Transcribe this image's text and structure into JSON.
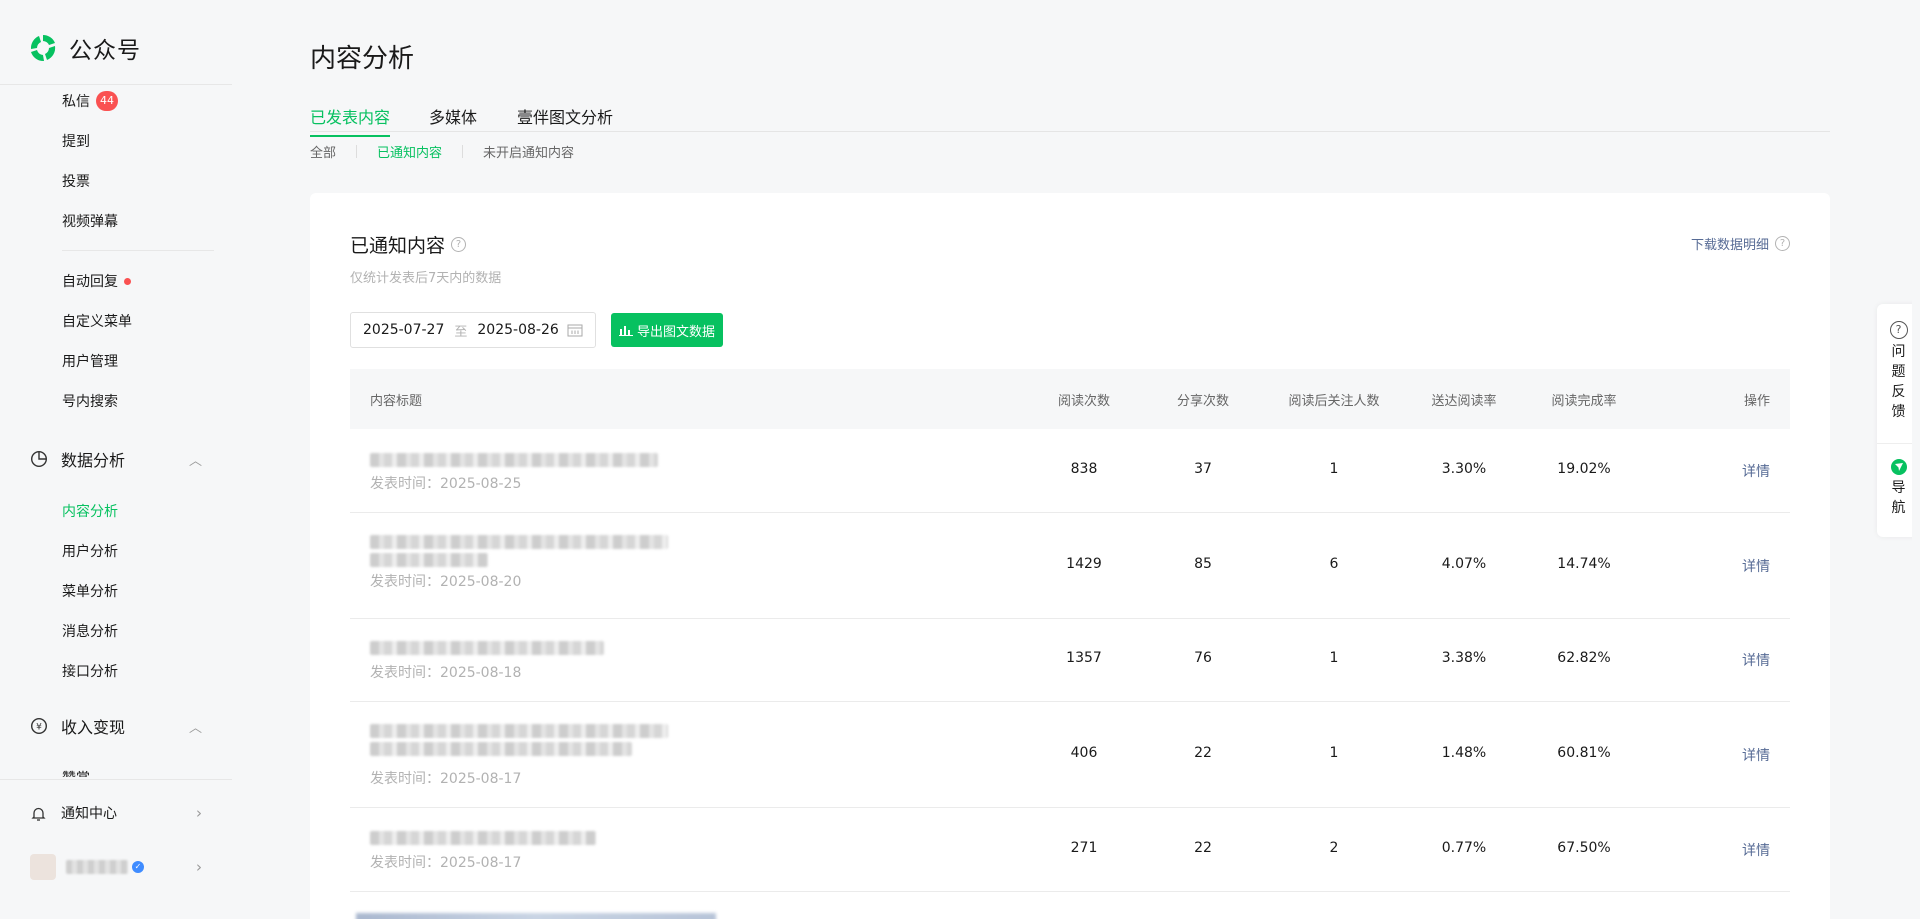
{
  "app": {
    "name": "公众号"
  },
  "sidebar": {
    "items_top": [
      {
        "label": "私信",
        "badge": "44"
      },
      {
        "label": "提到"
      },
      {
        "label": "投票"
      },
      {
        "label": "视频弹幕"
      }
    ],
    "items_mid": [
      {
        "label": "自动回复"
      },
      {
        "label": "自定义菜单"
      },
      {
        "label": "用户管理"
      },
      {
        "label": "号内搜索"
      }
    ],
    "group_data": {
      "label": "数据分析"
    },
    "items_data": [
      {
        "label": "内容分析",
        "active": true
      },
      {
        "label": "用户分析"
      },
      {
        "label": "菜单分析"
      },
      {
        "label": "消息分析"
      },
      {
        "label": "接口分析"
      }
    ],
    "group_income": {
      "label": "收入变现"
    },
    "cut_item": "赞赏",
    "notification_center": "通知中心"
  },
  "page": {
    "title": "内容分析",
    "tabs": [
      {
        "label": "已发表内容",
        "active": true
      },
      {
        "label": "多媒体"
      },
      {
        "label": "壹伴图文分析"
      }
    ],
    "subtabs": [
      {
        "label": "全部"
      },
      {
        "label": "已通知内容",
        "active": true
      },
      {
        "label": "未开启通知内容"
      }
    ]
  },
  "card": {
    "title": "已通知内容",
    "desc": "仅统计发表后7天内的数据",
    "download": "下载数据明细",
    "date_start": "2025-07-27",
    "date_to": "至",
    "date_end": "2025-08-26",
    "export": "导出图文数据"
  },
  "table": {
    "headers": {
      "title": "内容标题",
      "reads": "阅读次数",
      "shares": "分享次数",
      "follows": "阅读后关注人数",
      "reach_rate": "送达阅读率",
      "complete_rate": "阅读完成率",
      "action": "操作"
    },
    "rows": [
      {
        "time": "发表时间：2025-08-25",
        "reads": "838",
        "shares": "37",
        "follows": "1",
        "reach_rate": "3.30%",
        "complete_rate": "19.02%",
        "action": "详情"
      },
      {
        "time": "发表时间：2025-08-20",
        "reads": "1429",
        "shares": "85",
        "follows": "6",
        "reach_rate": "4.07%",
        "complete_rate": "14.74%",
        "action": "详情"
      },
      {
        "time": "发表时间：2025-08-18",
        "reads": "1357",
        "shares": "76",
        "follows": "1",
        "reach_rate": "3.38%",
        "complete_rate": "62.82%",
        "action": "详情"
      },
      {
        "time": "发表时间：2025-08-17",
        "reads": "406",
        "shares": "22",
        "follows": "1",
        "reach_rate": "1.48%",
        "complete_rate": "60.81%",
        "action": "详情"
      },
      {
        "time": "发表时间：2025-08-17",
        "reads": "271",
        "shares": "22",
        "follows": "2",
        "reach_rate": "0.77%",
        "complete_rate": "67.50%",
        "action": "详情"
      }
    ]
  },
  "float": {
    "feedback": [
      "问",
      "题",
      "反",
      "馈"
    ],
    "nav": [
      "导",
      "航"
    ]
  },
  "colors": {
    "brand": "#07c160",
    "link": "#576b95",
    "badge": "#fa5151"
  }
}
